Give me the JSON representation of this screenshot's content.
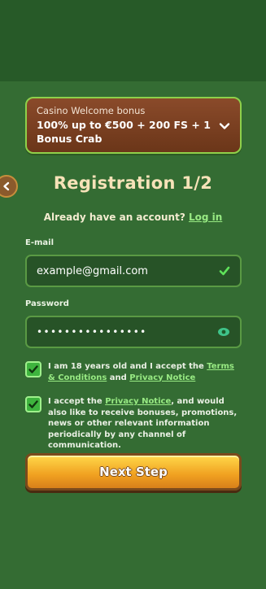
{
  "bonus": {
    "caption": "Casino Welcome bonus",
    "title": "100% up to €500 + 200 FS + 1 Bonus Crab"
  },
  "page": {
    "title": "Registration 1/2",
    "account_text": "Already have an account?",
    "login_link": "Log in"
  },
  "form": {
    "email_label": "E-mail",
    "email_value": "example@gmail.com",
    "password_label": "Password",
    "password_value": "••••••••••••••••"
  },
  "consents": {
    "age_text": "I am 18 years old and I accept the",
    "terms_link": "Terms & Conditions",
    "and_text": "and",
    "privacy_link": "Privacy Notice",
    "marketing_prefix": "I accept the",
    "marketing_privacy_link": "Privacy Notice",
    "marketing_suffix": ", and would also like to receive bonuses, promotions, news or other relevant information periodically by any channel of communication."
  },
  "actions": {
    "next_label": "Next Step"
  },
  "colors": {
    "background": "#336a32",
    "accent_link": "#98ea83",
    "button": "#f0a020"
  }
}
